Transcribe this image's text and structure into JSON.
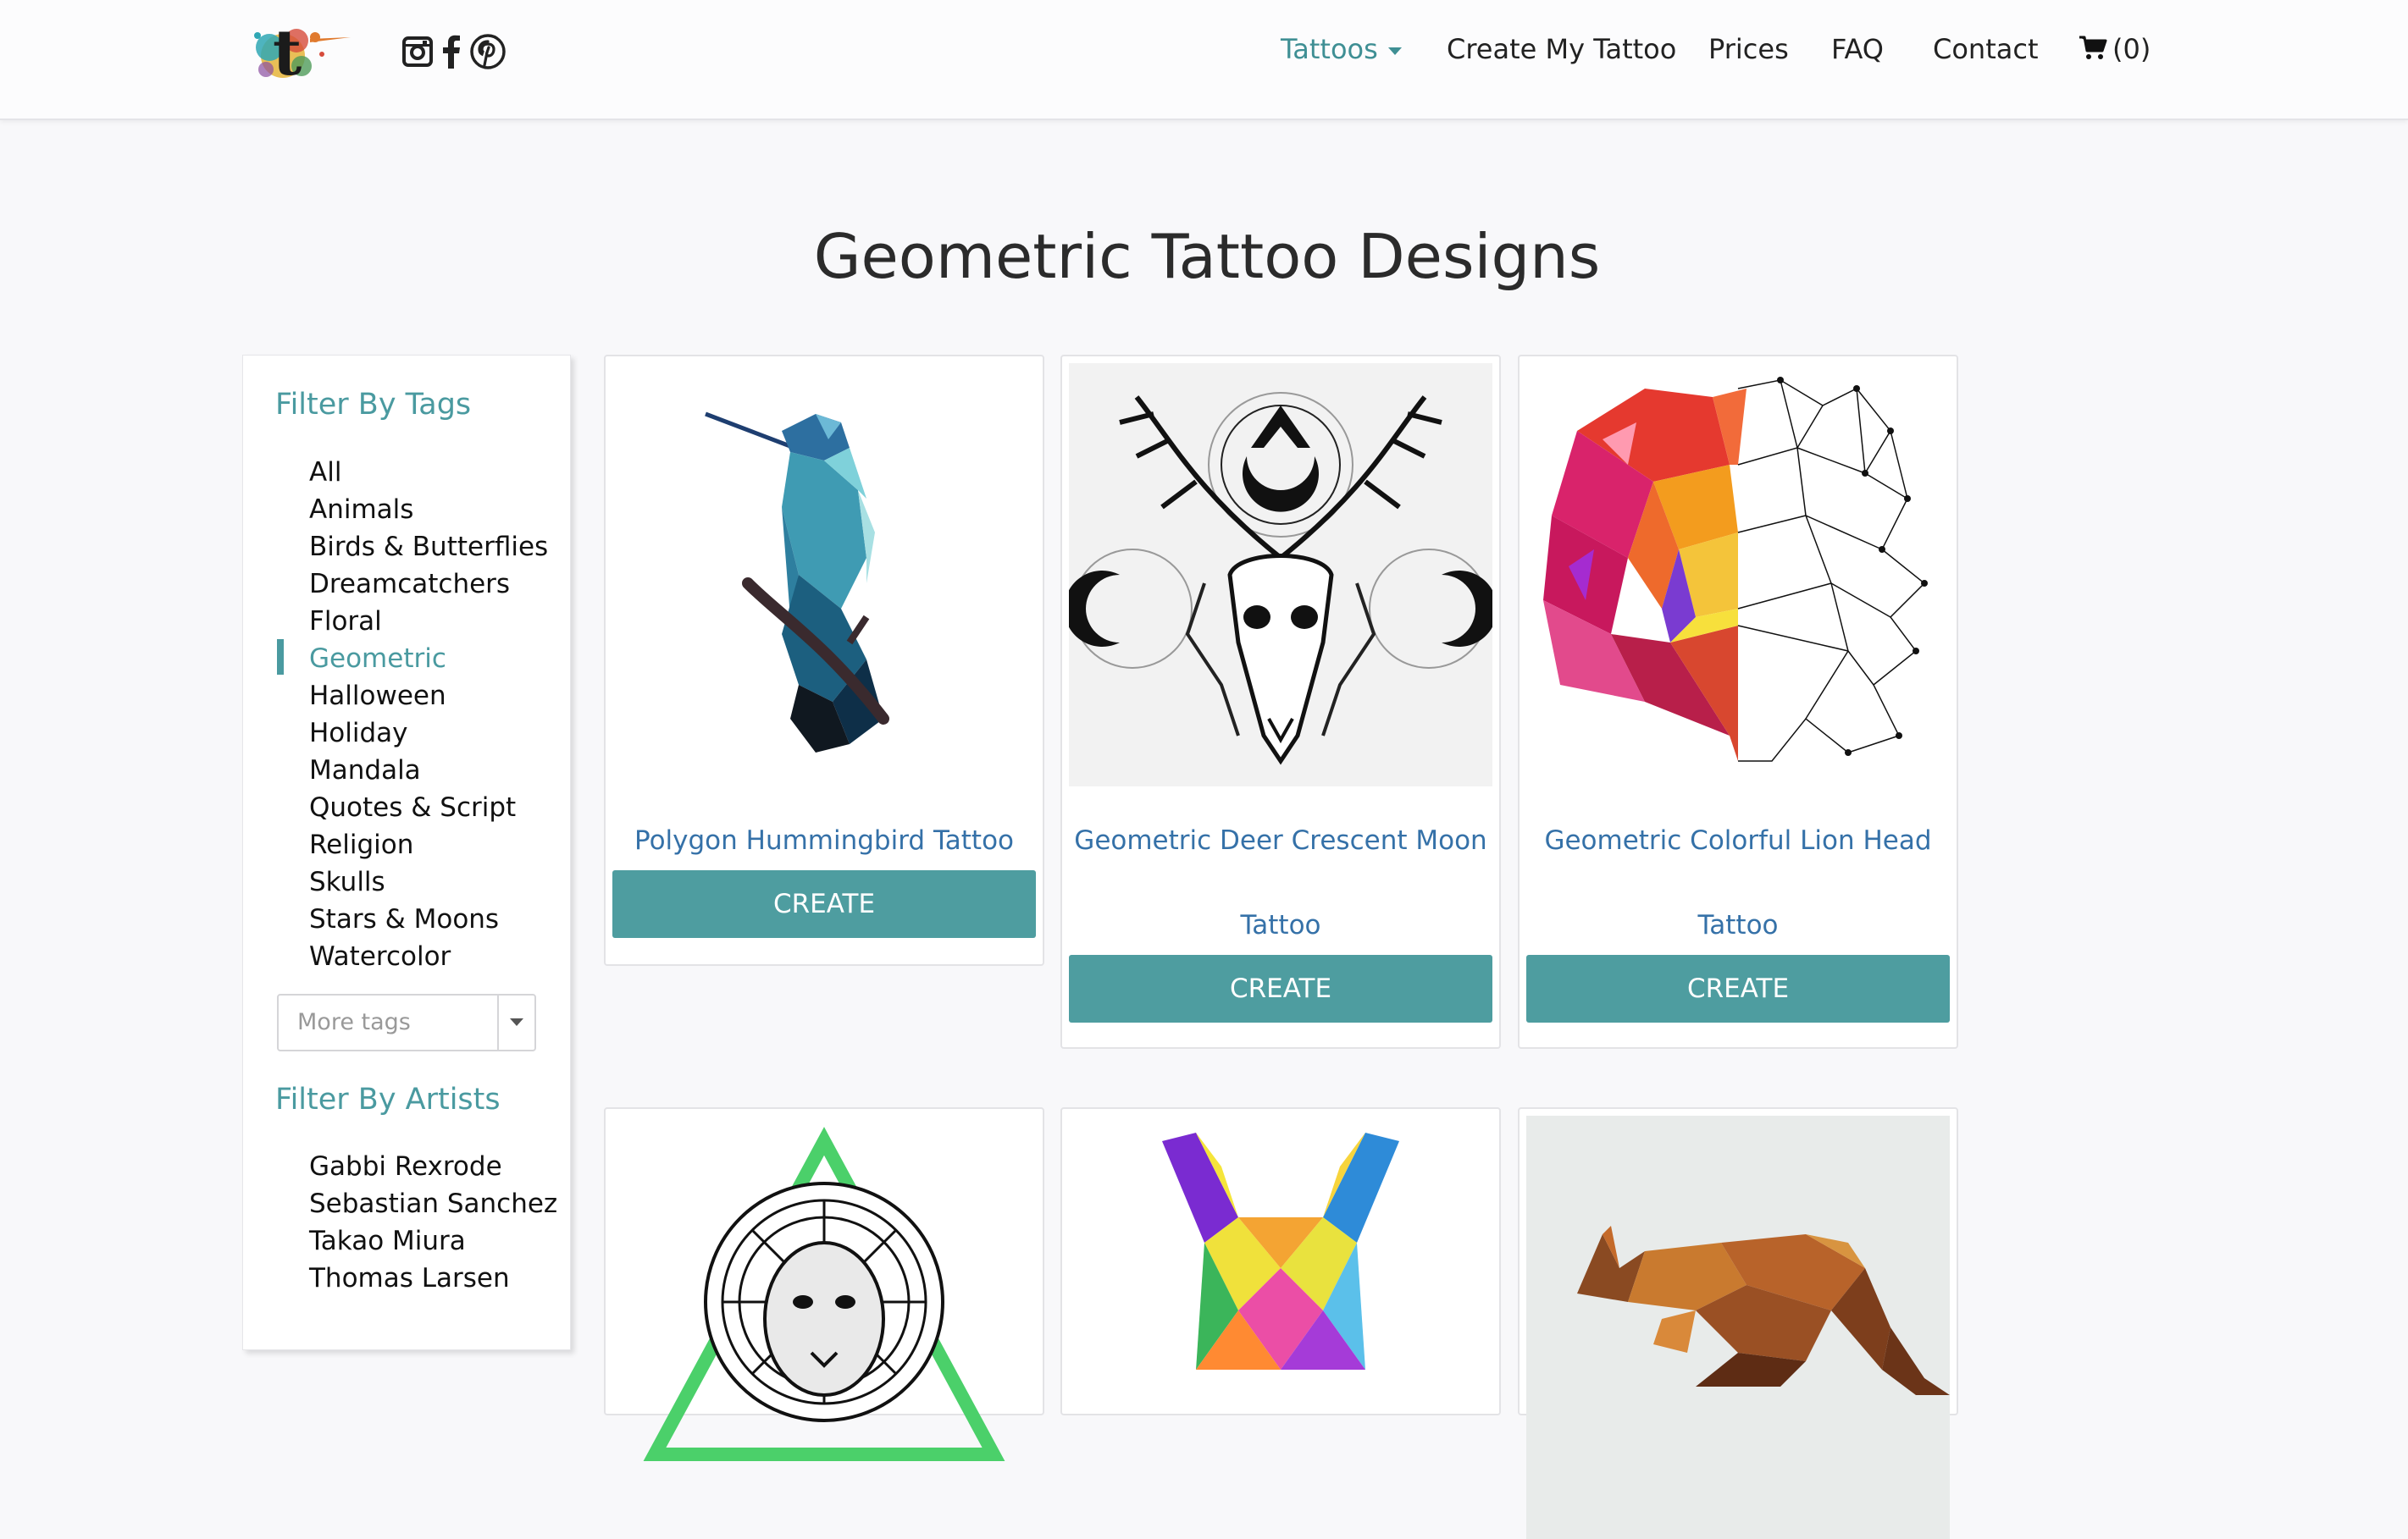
{
  "header": {
    "logo_letter": "t",
    "social": [
      "instagram-icon",
      "facebook-icon",
      "pinterest-icon"
    ],
    "nav": {
      "tattoos": "Tattoos",
      "create": "Create My Tattoo",
      "prices": "Prices",
      "faq": "FAQ",
      "contact": "Contact",
      "cart": "(0)"
    },
    "accent_color": "#3f8f94"
  },
  "page": {
    "title": "Geometric Tattoo Designs"
  },
  "sidebar": {
    "tags_heading": "Filter By Tags",
    "tags": [
      "All",
      "Animals",
      "Birds & Butterflies",
      "Dreamcatchers",
      "Floral",
      "Geometric",
      "Halloween",
      "Holiday",
      "Mandala",
      "Quotes & Script",
      "Religion",
      "Skulls",
      "Stars & Moons",
      "Watercolor"
    ],
    "active_tag": "Geometric",
    "more_tags_placeholder": "More tags",
    "artists_heading": "Filter By Artists",
    "artists": [
      "Gabbi Rexrode",
      "Sebastian Sanchez",
      "Takao Miura",
      "Thomas Larsen"
    ]
  },
  "cards": [
    {
      "title_line1": "Polygon Hummingbird Tattoo",
      "title_line2": "",
      "button": "CREATE",
      "image": "hummingbird-image"
    },
    {
      "title_line1": "Geometric Deer Crescent Moon",
      "title_line2": "Tattoo",
      "button": "CREATE",
      "image": "deer-moon-image"
    },
    {
      "title_line1": "Geometric Colorful Lion Head",
      "title_line2": "Tattoo",
      "button": "CREATE",
      "image": "lion-head-image"
    },
    {
      "image": "mandala-lion-image"
    },
    {
      "image": "geometric-dog-image"
    },
    {
      "image": "kangaroo-image"
    }
  ],
  "colors": {
    "button": "#4e9da0",
    "link": "#3571a8",
    "heading": "#4a9aa0"
  }
}
